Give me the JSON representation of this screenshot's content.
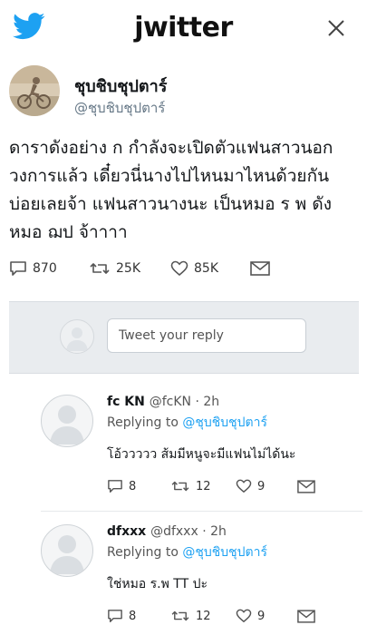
{
  "header": {
    "app_name": "jwitter",
    "colors": {
      "bird": "#1da1f2",
      "link": "#1da1f2"
    },
    "icons": {
      "logo": "bird-icon",
      "close": "close-icon"
    }
  },
  "tweet": {
    "author_name": "ชุบชิบชุปตาร์",
    "author_handle": "@ชุบชิบชุปตาร์",
    "text": "ดาราดังอย่าง ก กำลังจะเปิดตัวแฟนสาวนอก\nวงการแล้ว เดี๋ยวนี่นางไปไหนมาไหนด้วยกัน\nบ่อยเลยจ้า แฟนสาวนางนะ เป็นหมอ ร พ ดัง\nหมอ ฌป จ้าาาา",
    "actions": {
      "replies": "870",
      "retweets": "25K",
      "likes": "85K"
    }
  },
  "compose": {
    "placeholder": "Tweet your reply"
  },
  "replies": [
    {
      "name": "fc KN",
      "meta": "@fcKN · 2h",
      "replying_prefix": "Replying to",
      "replying_to": "@ชุบชิบชุปตาร์",
      "text": "โอ้ววววว ส้มมีหนูจะมีแฟนไม่ได้นะ",
      "replies": "8",
      "retweets": "12",
      "likes": "9"
    },
    {
      "name": "dfxxx",
      "meta": "@dfxxx · 2h",
      "replying_prefix": "Replying to",
      "replying_to": "@ชุบชิบชุปตาร์",
      "text": "ใช่หมอ ร.พ TT ปะ",
      "replies": "8",
      "retweets": "12",
      "likes": "9"
    }
  ]
}
